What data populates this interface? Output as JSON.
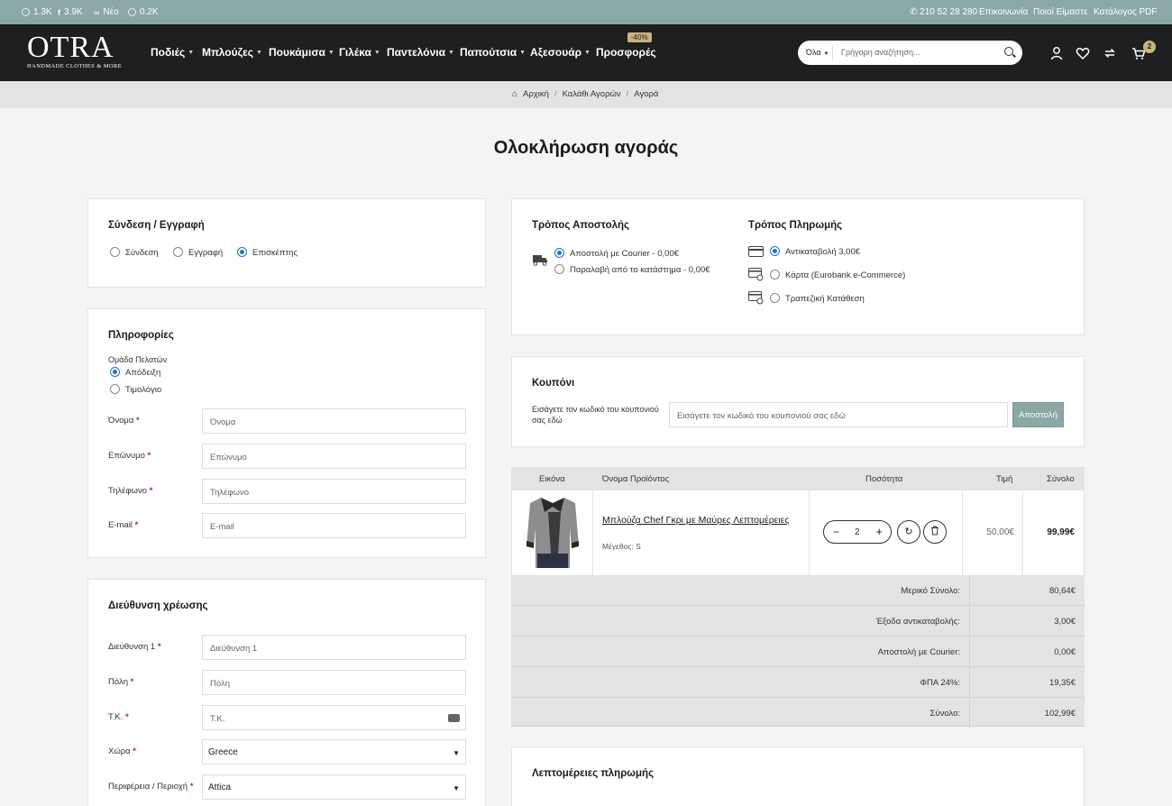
{
  "topbar": {
    "stats": [
      {
        "icon": "instagram-icon",
        "value": "1.3K"
      },
      {
        "icon": "facebook-icon",
        "value": "3.9K"
      },
      {
        "icon": "link-icon",
        "value": "Νέο"
      },
      {
        "icon": "pinterest-icon",
        "value": "0.2K"
      }
    ],
    "phone": "210 52 28 280",
    "links": [
      "Επικοινωνία",
      "Ποιοί Είμαστε",
      "Κατάλογος PDF"
    ]
  },
  "header": {
    "logo_big": "OTRA",
    "logo_small": "HANDMADE CLOTHES & MORE",
    "nav": [
      "Ποδιές",
      "Μπλούζες",
      "Πουκάμισα",
      "Γιλέκα",
      "Παντελόνια",
      "Παπούτσια",
      "Αξεσουάρ",
      "Προσφορές"
    ],
    "promo_badge": "-40%",
    "search_category": "Όλα",
    "search_placeholder": "Γρήγορη αναζήτηση...",
    "cart_count": "2"
  },
  "breadcrumb": [
    "Αρχική",
    "Καλάθι Αγορών",
    "Αγορά"
  ],
  "page_title": "Ολοκλήρωση αγοράς",
  "login": {
    "title": "Σύνδεση / Εγγραφή",
    "options": [
      "Σύνδεση",
      "Εγγραφή",
      "Επισκέπτης"
    ],
    "selected": "Επισκέπτης"
  },
  "info": {
    "title": "Πληροφορίες",
    "group_label": "Ομάδα Πελατών",
    "group_options": [
      "Απόδειξη",
      "Τιμολόγιο"
    ],
    "group_selected": "Απόδειξη",
    "fields": [
      {
        "label": "Όνομα",
        "placeholder": "Όνομα"
      },
      {
        "label": "Επώνυμο",
        "placeholder": "Επώνυμο"
      },
      {
        "label": "Τηλέφωνο",
        "placeholder": "Τηλέφωνο"
      },
      {
        "label": "E-mail",
        "placeholder": "E-mail"
      }
    ]
  },
  "billing": {
    "title": "Διεύθυνση χρέωσης",
    "fields": [
      {
        "label": "Διεύθυνση 1",
        "placeholder": "Διεύθυνση 1"
      },
      {
        "label": "Πόλη",
        "placeholder": "Πόλη"
      },
      {
        "label": "Τ.Κ.",
        "placeholder": "Τ.Κ."
      }
    ],
    "country_label": "Χώρα",
    "country_value": "Greece",
    "region_label": "Περιφέρεια / Περιοχή",
    "region_value": "Attica"
  },
  "shipping": {
    "title": "Τρόπος Αποστολής",
    "options": [
      "Αποστολή με Courier - 0,00€",
      "Παραλαβή από το κατάστημα - 0,00€"
    ],
    "selected": "Αποστολή με Courier - 0,00€"
  },
  "payment": {
    "title": "Τρόπος Πληρωμής",
    "options": [
      "Αντικαταβολή 3,00€",
      "Κάρτα (Eurobank e-Commerce)",
      "Τραπεζική Κατάθεση"
    ],
    "selected": "Αντικαταβολή 3,00€"
  },
  "coupon": {
    "title": "Κουπόνι",
    "label": "Εισάγετε τον κωδικό του κουπονιού σας εδώ",
    "placeholder": "Εισάγετε τον κωδικό του κουπονιού σας εδώ",
    "button": "Αποστολή"
  },
  "cart": {
    "headers": [
      "Εικόνα",
      "Όνομα Προϊόντος",
      "Ποσότητα",
      "Τιμή",
      "Σύνολο"
    ],
    "item": {
      "name": "Μπλούζα Chef Γκρι με Μαύρες Λεπτομέρειες",
      "option": "Μέγεθος: S",
      "qty": "2",
      "price": "50,00€",
      "total": "99,99€"
    }
  },
  "totals": [
    {
      "label": "Μερικό Σύνολο:",
      "value": "80,64€"
    },
    {
      "label": "Έξοδα αντικαταβολής:",
      "value": "3,00€"
    },
    {
      "label": "Αποστολή με Courier:",
      "value": "0,00€"
    },
    {
      "label": "ΦΠΑ 24%:",
      "value": "19,35€"
    },
    {
      "label": "Σύνολο:",
      "value": "102,99€"
    }
  ],
  "payment_details": {
    "title": "Λεπτομέρειες πληρωμής"
  },
  "colors": {
    "accent": "#8aa8a6",
    "header": "#1d1f20",
    "gold": "#c9b37c",
    "radio": "#1f6fd6",
    "required": "#c0282d"
  }
}
